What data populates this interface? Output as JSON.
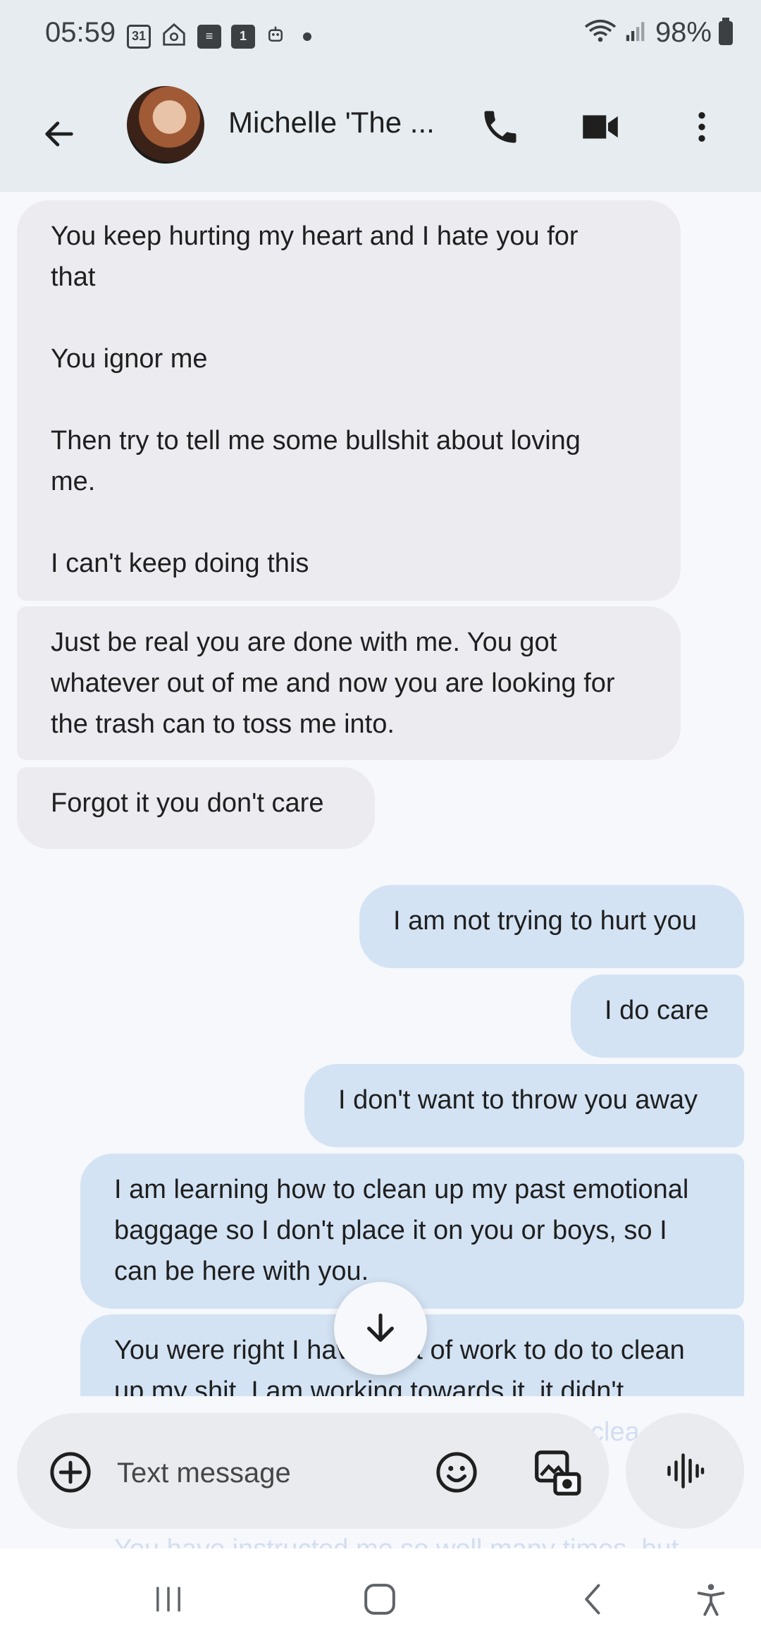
{
  "status_bar": {
    "time": "05:59",
    "calendar_day": "31",
    "badge_number": "1",
    "battery": "98%"
  },
  "header": {
    "contact_name": "Michelle 'The ..."
  },
  "messages": [
    {
      "direction": "incoming",
      "text": "You keep hurting my heart and I hate you for\nthat\n\nYou ignor me\n\nThen try to tell me some bullshit about loving\nme.\n\nI can't keep doing this"
    },
    {
      "direction": "incoming",
      "text": "Just be real you are done with me. You got\nwhatever out of me and now you are looking for\nthe trash can to toss me into."
    },
    {
      "direction": "incoming",
      "text": "Forgot it you don't care"
    },
    {
      "direction": "outgoing",
      "text": "I am not trying to hurt you"
    },
    {
      "direction": "outgoing",
      "text": "I do care"
    },
    {
      "direction": "outgoing",
      "text": "I don't want to throw you away"
    },
    {
      "direction": "outgoing",
      "text": "I am learning how to clean up my past emotional\nbaggage so I don't place it on you or boys, so I\ncan be here with you."
    },
    {
      "direction": "outgoing",
      "text": "You were right I have a lot of work to do to clean\nup my shit. I am working towards it, it didn't"
    }
  ],
  "partial_texts": {
    "behind_compose": "clea",
    "below_compose": "You have instructed me so well many times, but"
  },
  "compose": {
    "placeholder": "Text message"
  },
  "colors": {
    "app_bar": "#e6ecf0",
    "background": "#f6f8fc",
    "incoming_bubble": "#ebebf0",
    "outgoing_bubble": "#d3e3f4"
  }
}
